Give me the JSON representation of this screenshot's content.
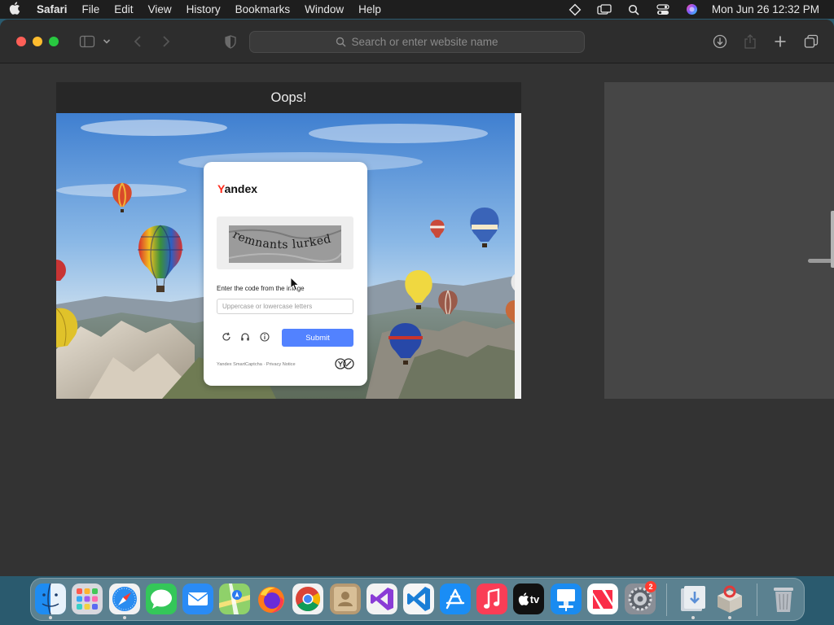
{
  "menubar": {
    "apple_icon": "apple-logo",
    "app_name": "Safari",
    "items": [
      "File",
      "Edit",
      "View",
      "History",
      "Bookmarks",
      "Window",
      "Help"
    ],
    "status_icons": [
      "diamond-icon",
      "screen-mirror-icon",
      "spotlight-icon",
      "control-center-icon",
      "siri-icon"
    ],
    "clock": "Mon Jun 26  12:32 PM"
  },
  "safari": {
    "address_placeholder": "Search or enter website name",
    "toolbar_icons": [
      "sidebar-icon",
      "chevron-down-icon",
      "back-icon",
      "forward-icon",
      "privacy-shield-icon",
      "download-icon",
      "share-icon",
      "new-tab-icon",
      "tab-overview-icon"
    ]
  },
  "tab_preview": {
    "title": "Oops!",
    "captcha": {
      "logo": "Yandex",
      "captcha_text": "remnants lurked",
      "prompt": "Enter the code from the image",
      "input_placeholder": "Uppercase or lowercase letters",
      "submit_label": "Submit",
      "footer": "Yandex SmartCaptcha · Privacy Notice",
      "accent_color": "#5282ff"
    }
  },
  "dock": {
    "apps": [
      {
        "name": "Finder",
        "icon": "finder-icon"
      },
      {
        "name": "Launchpad",
        "icon": "launchpad-icon"
      },
      {
        "name": "Safari",
        "icon": "safari-icon"
      },
      {
        "name": "Messages",
        "icon": "messages-icon"
      },
      {
        "name": "Mail",
        "icon": "mail-icon"
      },
      {
        "name": "Maps",
        "icon": "maps-icon"
      },
      {
        "name": "Firefox",
        "icon": "firefox-icon"
      },
      {
        "name": "Chrome",
        "icon": "chrome-icon"
      },
      {
        "name": "Contacts",
        "icon": "contacts-icon"
      },
      {
        "name": "Visual Studio",
        "icon": "visual-studio-icon"
      },
      {
        "name": "VS Code",
        "icon": "vscode-icon"
      },
      {
        "name": "App Store",
        "icon": "app-store-icon"
      },
      {
        "name": "Music",
        "icon": "music-icon"
      },
      {
        "name": "TV",
        "icon": "tv-icon"
      },
      {
        "name": "Keynote",
        "icon": "keynote-icon"
      },
      {
        "name": "News",
        "icon": "news-icon"
      },
      {
        "name": "System Settings",
        "icon": "settings-icon"
      },
      {
        "name": "Downloads",
        "icon": "downloads-icon"
      },
      {
        "name": "Installer",
        "icon": "installer-icon"
      },
      {
        "name": "Trash",
        "icon": "trash-icon"
      }
    ],
    "tv_label": "tv",
    "settings_badge": "2"
  }
}
